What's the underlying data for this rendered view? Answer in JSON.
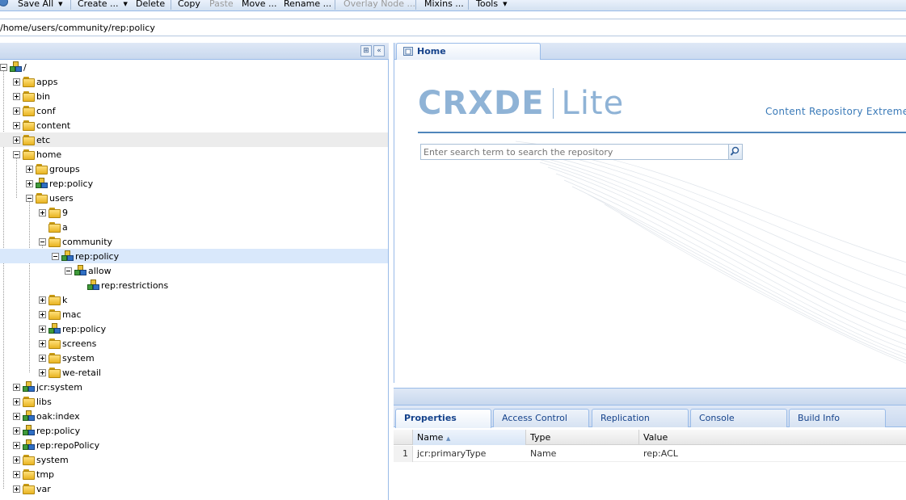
{
  "toolbar": {
    "items": [
      {
        "label": "Save All",
        "caret": "▼",
        "disabled": false
      },
      {
        "label": "Create ...",
        "caret": "▼",
        "disabled": false
      },
      {
        "label": "Delete",
        "disabled": false
      },
      {
        "label": "Copy",
        "disabled": false
      },
      {
        "label": "Paste",
        "disabled": true
      },
      {
        "label": "Move ...",
        "disabled": false
      },
      {
        "label": "Rename ...",
        "disabled": false
      },
      {
        "label": "Overlay Node ...",
        "disabled": true
      },
      {
        "label": "Mixins ...",
        "disabled": false
      },
      {
        "label": "Tools",
        "caret": "▼",
        "disabled": false
      }
    ]
  },
  "path": {
    "value": "/home/users/community/rep:policy"
  },
  "tree": {
    "nodes": [
      {
        "label": "/",
        "icon": "cubes-icon",
        "toggle": "minus"
      },
      {
        "label": "apps",
        "icon": "folder-icon",
        "toggle": "plus"
      },
      {
        "label": "bin",
        "icon": "folder-icon",
        "toggle": "plus"
      },
      {
        "label": "conf",
        "icon": "folder-icon",
        "toggle": "plus"
      },
      {
        "label": "content",
        "icon": "folder-icon",
        "toggle": "plus"
      },
      {
        "label": "etc",
        "icon": "folder-icon",
        "toggle": "plus"
      },
      {
        "label": "home",
        "icon": "folder-icon",
        "toggle": "minus"
      },
      {
        "label": "groups",
        "icon": "folder-icon",
        "toggle": "plus"
      },
      {
        "label": "rep:policy",
        "icon": "cubes-icon",
        "toggle": "plus"
      },
      {
        "label": "users",
        "icon": "folder-icon",
        "toggle": "minus"
      },
      {
        "label": "9",
        "icon": "folder-icon",
        "toggle": "plus"
      },
      {
        "label": "a",
        "icon": "folder-icon",
        "toggle": "none"
      },
      {
        "label": "community",
        "icon": "folder-icon",
        "toggle": "minus"
      },
      {
        "label": "rep:policy",
        "icon": "cubes-icon",
        "toggle": "minus"
      },
      {
        "label": "allow",
        "icon": "cubes-icon",
        "toggle": "minus"
      },
      {
        "label": "rep:restrictions",
        "icon": "cubes-icon",
        "toggle": "none"
      },
      {
        "label": "k",
        "icon": "folder-icon",
        "toggle": "plus"
      },
      {
        "label": "mac",
        "icon": "folder-icon",
        "toggle": "plus"
      },
      {
        "label": "rep:policy",
        "icon": "cubes-icon",
        "toggle": "plus"
      },
      {
        "label": "screens",
        "icon": "folder-icon",
        "toggle": "plus"
      },
      {
        "label": "system",
        "icon": "folder-icon",
        "toggle": "plus"
      },
      {
        "label": "we-retail",
        "icon": "folder-icon",
        "toggle": "plus"
      },
      {
        "label": "jcr:system",
        "icon": "cubes-icon",
        "toggle": "plus"
      },
      {
        "label": "libs",
        "icon": "folder-icon",
        "toggle": "plus"
      },
      {
        "label": "oak:index",
        "icon": "cubes-icon",
        "toggle": "plus"
      },
      {
        "label": "rep:policy",
        "icon": "cubes-icon",
        "toggle": "plus"
      },
      {
        "label": "rep:repoPolicy",
        "icon": "cubes-icon",
        "toggle": "plus"
      },
      {
        "label": "system",
        "icon": "folder-icon",
        "toggle": "plus"
      },
      {
        "label": "tmp",
        "icon": "folder-icon",
        "toggle": "plus"
      },
      {
        "label": "var",
        "icon": "folder-icon",
        "toggle": "plus"
      }
    ]
  },
  "home": {
    "tab_label": "Home",
    "title_bold": "CRXDE",
    "title_light": "Lite",
    "subtitle": "Content Repository Extreme Development Environment",
    "search_placeholder": "Enter search term to search the repository"
  },
  "props": {
    "tabs": [
      "Properties",
      "Access Control",
      "Replication",
      "Console",
      "Build Info"
    ],
    "columns": [
      "Name",
      "Type",
      "Value"
    ],
    "sort_indicator": "▲",
    "rows": [
      {
        "num": "1",
        "name": "jcr:primaryType",
        "type": "Name",
        "value": "rep:ACL"
      }
    ]
  }
}
